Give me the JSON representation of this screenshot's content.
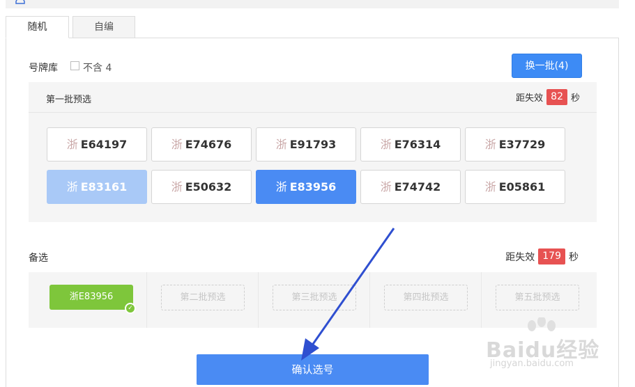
{
  "tabs": [
    {
      "label": "随机",
      "active": true
    },
    {
      "label": "自编",
      "active": false
    }
  ],
  "library": {
    "label": "号牌库",
    "exclude_four_label": "不含 4",
    "exclude_four_checked": false,
    "swap_button": "换一批(4)"
  },
  "batch": {
    "title": "第一批预选",
    "expire_label": "距失效",
    "expire_value": "82",
    "expire_unit": "秒",
    "plates": [
      {
        "province": "浙",
        "number": "E64197",
        "state": "normal"
      },
      {
        "province": "浙",
        "number": "E74676",
        "state": "normal"
      },
      {
        "province": "浙",
        "number": "E91793",
        "state": "normal"
      },
      {
        "province": "浙",
        "number": "E76314",
        "state": "normal"
      },
      {
        "province": "浙",
        "number": "E37729",
        "state": "normal"
      },
      {
        "province": "浙",
        "number": "E83161",
        "state": "light"
      },
      {
        "province": "浙",
        "number": "E50632",
        "state": "normal"
      },
      {
        "province": "浙",
        "number": "E83956",
        "state": "selected"
      },
      {
        "province": "浙",
        "number": "E74742",
        "state": "normal"
      },
      {
        "province": "浙",
        "number": "E05861",
        "state": "normal"
      }
    ]
  },
  "alternates": {
    "label": "备选",
    "expire_label": "距失效",
    "expire_value": "179",
    "expire_unit": "秒",
    "chosen": "浙E83956",
    "slots": [
      "第二批预选",
      "第三批预选",
      "第四批预选",
      "第五批预选"
    ]
  },
  "confirm_button": "确认选号",
  "watermark": {
    "text": "Baidu经验",
    "sub": "jingyan.baidu.com"
  },
  "colors": {
    "primary": "#4a8bf3",
    "accent_green": "#7ec63b",
    "timer_red": "#e75252"
  }
}
